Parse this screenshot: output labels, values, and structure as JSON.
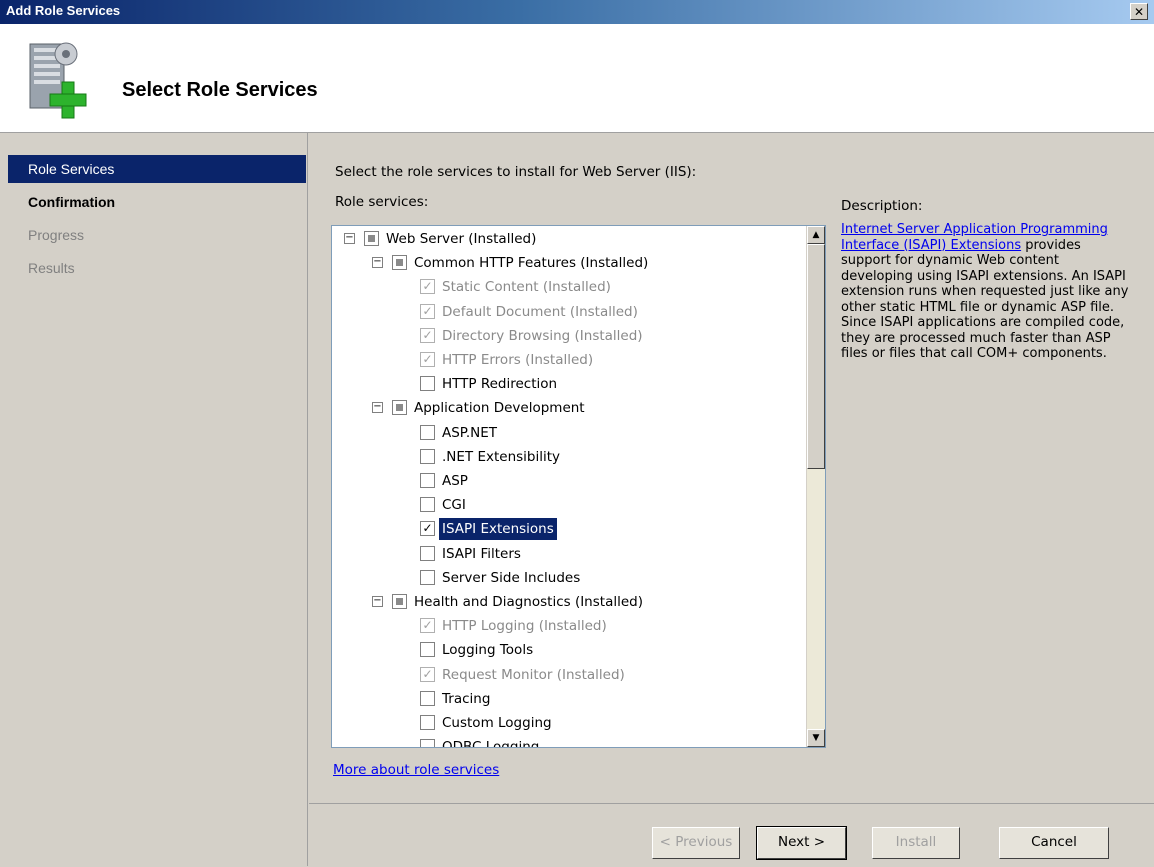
{
  "window": {
    "title": "Add Role Services",
    "close_glyph": "✕"
  },
  "header": {
    "title": "Select Role Services",
    "icon": "server-add-icon"
  },
  "nav": {
    "items": [
      {
        "label": "Role Services",
        "state": "active"
      },
      {
        "label": "Confirmation",
        "state": "bold"
      },
      {
        "label": "Progress",
        "state": "disabled"
      },
      {
        "label": "Results",
        "state": "disabled"
      }
    ]
  },
  "main": {
    "instruction": "Select the role services to install for Web Server (IIS):",
    "role_services_label": "Role services:",
    "description_label": "Description:"
  },
  "tree": {
    "rows": [
      {
        "label": "Web Server  (Installed)",
        "checkbox": "partial",
        "expander": "⊟",
        "grey": false,
        "selected": false
      },
      {
        "label": "Common HTTP Features  (Installed)",
        "checkbox": "partial",
        "expander": "⊟",
        "grey": false,
        "selected": false
      },
      {
        "label": "Static Content  (Installed)",
        "checkbox": "checked-grey",
        "grey": true,
        "selected": false
      },
      {
        "label": "Default Document  (Installed)",
        "checkbox": "checked-grey",
        "grey": true,
        "selected": false
      },
      {
        "label": "Directory Browsing  (Installed)",
        "checkbox": "checked-grey",
        "grey": true,
        "selected": false
      },
      {
        "label": "HTTP Errors  (Installed)",
        "checkbox": "checked-grey",
        "grey": true,
        "selected": false
      },
      {
        "label": "HTTP Redirection",
        "checkbox": "unchecked",
        "grey": false,
        "selected": false
      },
      {
        "label": "Application Development",
        "checkbox": "partial",
        "expander": "⊟",
        "grey": false,
        "selected": false
      },
      {
        "label": "ASP.NET",
        "checkbox": "unchecked",
        "grey": false,
        "selected": false
      },
      {
        "label": ".NET Extensibility",
        "checkbox": "unchecked",
        "grey": false,
        "selected": false
      },
      {
        "label": "ASP",
        "checkbox": "unchecked",
        "grey": false,
        "selected": false
      },
      {
        "label": "CGI",
        "checkbox": "unchecked",
        "grey": false,
        "selected": false
      },
      {
        "label": "ISAPI Extensions",
        "checkbox": "checked",
        "grey": false,
        "selected": true
      },
      {
        "label": "ISAPI Filters",
        "checkbox": "unchecked",
        "grey": false,
        "selected": false
      },
      {
        "label": "Server Side Includes",
        "checkbox": "unchecked",
        "grey": false,
        "selected": false
      },
      {
        "label": "Health and Diagnostics  (Installed)",
        "checkbox": "partial",
        "expander": "⊟",
        "grey": false,
        "selected": false
      },
      {
        "label": "HTTP Logging  (Installed)",
        "checkbox": "checked-grey",
        "grey": true,
        "selected": false
      },
      {
        "label": "Logging Tools",
        "checkbox": "unchecked",
        "grey": false,
        "selected": false
      },
      {
        "label": "Request Monitor  (Installed)",
        "checkbox": "checked-grey",
        "grey": true,
        "selected": false
      },
      {
        "label": "Tracing",
        "checkbox": "unchecked",
        "grey": false,
        "selected": false
      },
      {
        "label": "Custom Logging",
        "checkbox": "unchecked",
        "grey": false,
        "selected": false
      },
      {
        "label": "ODBC Logging",
        "checkbox": "unchecked",
        "grey": false,
        "selected": false
      }
    ],
    "scroll_up_glyph": "▲",
    "scroll_down_glyph": "▼",
    "check_glyph": "✓"
  },
  "description": {
    "link_text": "Internet Server Application Programming Interface (ISAPI) Extensions",
    "body": " provides support for dynamic Web content developing using ISAPI extensions. An ISAPI extension runs when requested just like any other static HTML file or dynamic ASP file. Since ISAPI applications are compiled code, they are processed much faster than ASP files or files that call COM+ components."
  },
  "more_link": "More about role services",
  "buttons": {
    "previous": "< Previous",
    "next": "Next >",
    "install": "Install",
    "cancel": "Cancel"
  }
}
